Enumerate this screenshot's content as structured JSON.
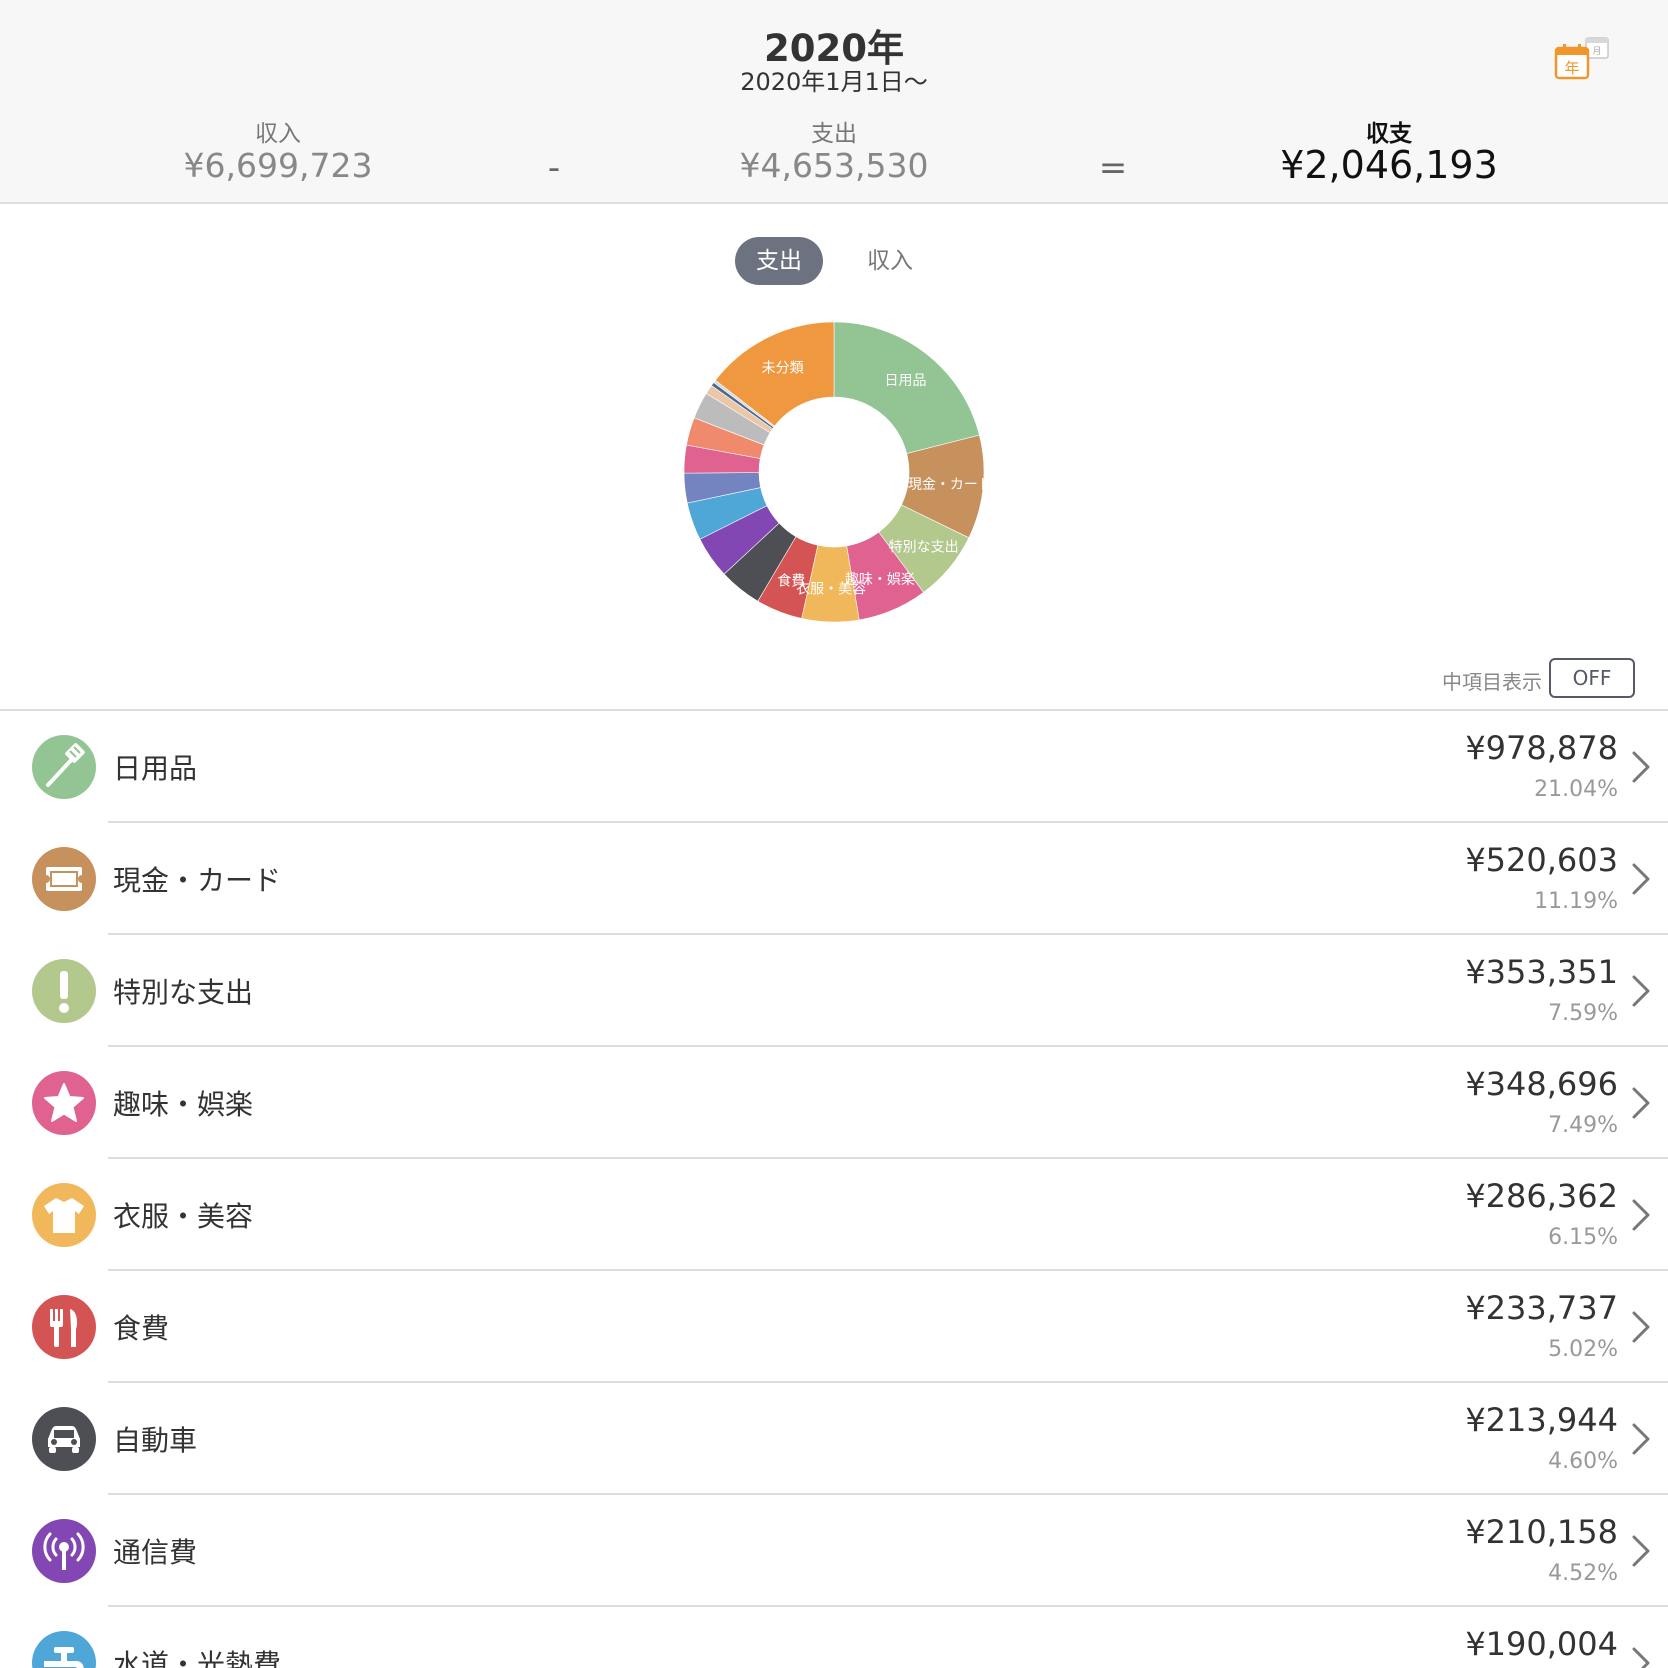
{
  "header": {
    "year_title": "2020年",
    "period": "2020年1月1日〜",
    "calendar_badge_year": "年",
    "calendar_badge_month": "月",
    "income_label": "収入",
    "income_value": "¥6,699,723",
    "minus_sign": "-",
    "expense_label": "支出",
    "expense_value": "¥4,653,530",
    "equals_sign": "=",
    "balance_label": "収支",
    "balance_value": "¥2,046,193",
    "accent_color": "#f0962b"
  },
  "toggle": {
    "expense_label": "支出",
    "income_label": "収入",
    "selected": "支出"
  },
  "sub_items": {
    "label": "中項目表示",
    "state": "OFF"
  },
  "chart_data": {
    "type": "pie",
    "labels_shown": [
      "未分類",
      "日用品",
      "現金・カード",
      "特別な支出",
      "趣味・娯楽",
      "衣服・美容",
      "食費"
    ],
    "slices": [
      {
        "label": "日用品",
        "value": 21.04,
        "color": "#93c493"
      },
      {
        "label": "現金・カード",
        "value": 11.19,
        "color": "#c6915c"
      },
      {
        "label": "特別な支出",
        "value": 7.59,
        "color": "#b3c88c"
      },
      {
        "label": "趣味・娯楽",
        "value": 7.49,
        "color": "#df6290"
      },
      {
        "label": "衣服・美容",
        "value": 6.15,
        "color": "#f1b75b"
      },
      {
        "label": "食費",
        "value": 5.02,
        "color": "#d45454"
      },
      {
        "label": "自動車",
        "value": 4.6,
        "color": "#4d4f54"
      },
      {
        "label": "通信費",
        "value": 4.52,
        "color": "#8247b3"
      },
      {
        "label": "水道・光熱費",
        "value": 4.08,
        "color": "#4ea7d6"
      },
      {
        "label": "",
        "value": 3.2,
        "color": "#7484c0"
      },
      {
        "label": "",
        "value": 3.0,
        "color": "#df6290"
      },
      {
        "label": "",
        "value": 3.0,
        "color": "#ef8a6c"
      },
      {
        "label": "",
        "value": 2.9,
        "color": "#bcbcbc"
      },
      {
        "label": "",
        "value": 1.0,
        "color": "#ecc7a7"
      },
      {
        "label": "",
        "value": 0.4,
        "color": "#4d6a8c"
      },
      {
        "label": "",
        "value": 0.3,
        "color": "#d8d8d8"
      },
      {
        "label": "未分類",
        "value": 14.52,
        "color": "#f0983f"
      }
    ]
  },
  "categories": [
    {
      "name": "日用品",
      "amount": "¥978,878",
      "percent": "21.04%",
      "color": "#93c493",
      "icon": "toothbrush-icon"
    },
    {
      "name": "現金・カード",
      "amount": "¥520,603",
      "percent": "11.19%",
      "color": "#c6915c",
      "icon": "ticket-icon"
    },
    {
      "name": "特別な支出",
      "amount": "¥353,351",
      "percent": "7.59%",
      "color": "#b3c88c",
      "icon": "exclamation-icon"
    },
    {
      "name": "趣味・娯楽",
      "amount": "¥348,696",
      "percent": "7.49%",
      "color": "#df6290",
      "icon": "star-icon"
    },
    {
      "name": "衣服・美容",
      "amount": "¥286,362",
      "percent": "6.15%",
      "color": "#f1b75b",
      "icon": "tshirt-icon"
    },
    {
      "name": "食費",
      "amount": "¥233,737",
      "percent": "5.02%",
      "color": "#d45454",
      "icon": "fork-knife-icon"
    },
    {
      "name": "自動車",
      "amount": "¥213,944",
      "percent": "4.60%",
      "color": "#4d4f54",
      "icon": "car-icon"
    },
    {
      "name": "通信費",
      "amount": "¥210,158",
      "percent": "4.52%",
      "color": "#8247b3",
      "icon": "antenna-icon"
    },
    {
      "name": "水道・光熱費",
      "amount": "¥190,004",
      "percent": "",
      "color": "#4ea7d6",
      "icon": "faucet-icon"
    }
  ]
}
